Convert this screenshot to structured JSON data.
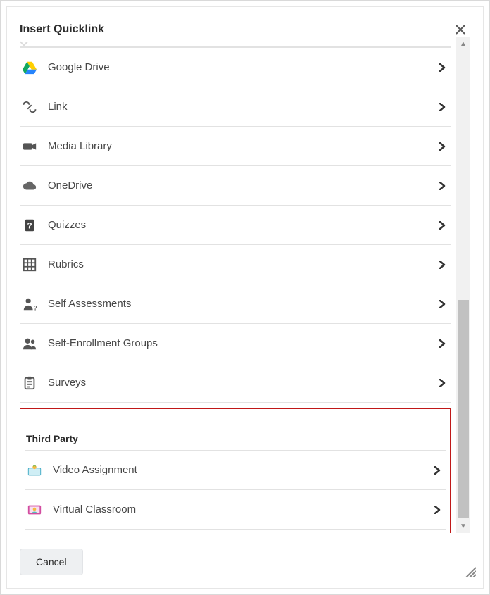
{
  "dialog": {
    "title": "Insert Quicklink",
    "close_label": "Close"
  },
  "list": [
    {
      "id": "google-drive",
      "label": "Google Drive",
      "icon": "google-drive"
    },
    {
      "id": "link",
      "label": "Link",
      "icon": "link"
    },
    {
      "id": "media-library",
      "label": "Media Library",
      "icon": "camera"
    },
    {
      "id": "onedrive",
      "label": "OneDrive",
      "icon": "cloud"
    },
    {
      "id": "quizzes",
      "label": "Quizzes",
      "icon": "question"
    },
    {
      "id": "rubrics",
      "label": "Rubrics",
      "icon": "grid"
    },
    {
      "id": "self-assess",
      "label": "Self Assessments",
      "icon": "person-q"
    },
    {
      "id": "self-enroll",
      "label": "Self-Enrollment Groups",
      "icon": "people"
    },
    {
      "id": "surveys",
      "label": "Surveys",
      "icon": "clipboard"
    }
  ],
  "third_party": {
    "header": "Third Party",
    "items": [
      {
        "id": "video-assignment",
        "label": "Video Assignment",
        "icon": "bongo-video"
      },
      {
        "id": "virtual-classroom",
        "label": "Virtual Classroom",
        "icon": "bongo-class"
      }
    ]
  },
  "footer": {
    "cancel": "Cancel"
  },
  "scrollbar": {
    "thumb_top_pct": 53,
    "thumb_height_pct": 44
  }
}
